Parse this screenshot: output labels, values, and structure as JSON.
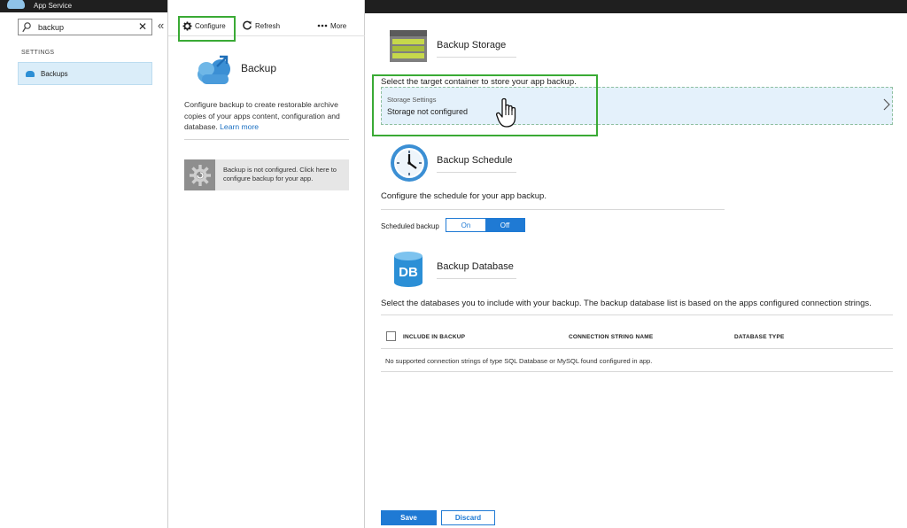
{
  "left_blade": {
    "subtitle": "App Service",
    "search": {
      "value": "backup",
      "placeholder": ""
    },
    "clear_glyph": "✕",
    "collapse_glyph": "«",
    "section_label": "SETTINGS",
    "nav_items": [
      {
        "label": "Backups",
        "icon": "cloud-icon",
        "selected": true
      }
    ]
  },
  "middle_blade": {
    "toolbar": {
      "configure_label": "Configure",
      "refresh_label": "Refresh",
      "more_label": "More"
    },
    "title": "Backup",
    "description": "Configure backup to create restorable archive copies of your apps content, configuration and database.",
    "learn_more": "Learn more",
    "notice": "Backup is not configured. Click here to configure backup for your app."
  },
  "right_blade": {
    "storage": {
      "title": "Backup Storage",
      "description": "Select the target container to store your app backup.",
      "settings_label": "Storage Settings",
      "settings_value": "Storage not configured"
    },
    "schedule": {
      "title": "Backup Schedule",
      "description": "Configure the schedule for your app backup.",
      "toggle_label": "Scheduled backup",
      "on_label": "On",
      "off_label": "Off",
      "selected": "Off"
    },
    "database": {
      "title": "Backup Database",
      "description": "Select the databases you to include with your backup. The backup database list is based on the apps configured connection strings.",
      "columns": [
        "INCLUDE IN BACKUP",
        "CONNECTION STRING NAME",
        "DATABASE TYPE"
      ],
      "empty_message": "No supported connection strings of type SQL Database or MySQL found configured in app.",
      "icon_text": "DB"
    },
    "buttons": {
      "save": "Save",
      "discard": "Discard"
    }
  },
  "colors": {
    "accent_blue": "#1f7ad4",
    "highlight_green": "#3aaa35",
    "selection_bg": "#daedf9",
    "link": "#1a6fc2"
  }
}
